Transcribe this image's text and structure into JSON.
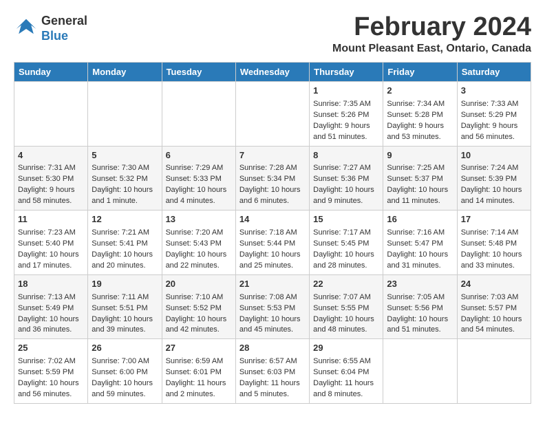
{
  "header": {
    "logo_line1": "General",
    "logo_line2": "Blue",
    "month": "February 2024",
    "location": "Mount Pleasant East, Ontario, Canada"
  },
  "days_of_week": [
    "Sunday",
    "Monday",
    "Tuesday",
    "Wednesday",
    "Thursday",
    "Friday",
    "Saturday"
  ],
  "weeks": [
    [
      {
        "day": "",
        "text": ""
      },
      {
        "day": "",
        "text": ""
      },
      {
        "day": "",
        "text": ""
      },
      {
        "day": "",
        "text": ""
      },
      {
        "day": "1",
        "text": "Sunrise: 7:35 AM\nSunset: 5:26 PM\nDaylight: 9 hours\nand 51 minutes."
      },
      {
        "day": "2",
        "text": "Sunrise: 7:34 AM\nSunset: 5:28 PM\nDaylight: 9 hours\nand 53 minutes."
      },
      {
        "day": "3",
        "text": "Sunrise: 7:33 AM\nSunset: 5:29 PM\nDaylight: 9 hours\nand 56 minutes."
      }
    ],
    [
      {
        "day": "4",
        "text": "Sunrise: 7:31 AM\nSunset: 5:30 PM\nDaylight: 9 hours\nand 58 minutes."
      },
      {
        "day": "5",
        "text": "Sunrise: 7:30 AM\nSunset: 5:32 PM\nDaylight: 10 hours\nand 1 minute."
      },
      {
        "day": "6",
        "text": "Sunrise: 7:29 AM\nSunset: 5:33 PM\nDaylight: 10 hours\nand 4 minutes."
      },
      {
        "day": "7",
        "text": "Sunrise: 7:28 AM\nSunset: 5:34 PM\nDaylight: 10 hours\nand 6 minutes."
      },
      {
        "day": "8",
        "text": "Sunrise: 7:27 AM\nSunset: 5:36 PM\nDaylight: 10 hours\nand 9 minutes."
      },
      {
        "day": "9",
        "text": "Sunrise: 7:25 AM\nSunset: 5:37 PM\nDaylight: 10 hours\nand 11 minutes."
      },
      {
        "day": "10",
        "text": "Sunrise: 7:24 AM\nSunset: 5:39 PM\nDaylight: 10 hours\nand 14 minutes."
      }
    ],
    [
      {
        "day": "11",
        "text": "Sunrise: 7:23 AM\nSunset: 5:40 PM\nDaylight: 10 hours\nand 17 minutes."
      },
      {
        "day": "12",
        "text": "Sunrise: 7:21 AM\nSunset: 5:41 PM\nDaylight: 10 hours\nand 20 minutes."
      },
      {
        "day": "13",
        "text": "Sunrise: 7:20 AM\nSunset: 5:43 PM\nDaylight: 10 hours\nand 22 minutes."
      },
      {
        "day": "14",
        "text": "Sunrise: 7:18 AM\nSunset: 5:44 PM\nDaylight: 10 hours\nand 25 minutes."
      },
      {
        "day": "15",
        "text": "Sunrise: 7:17 AM\nSunset: 5:45 PM\nDaylight: 10 hours\nand 28 minutes."
      },
      {
        "day": "16",
        "text": "Sunrise: 7:16 AM\nSunset: 5:47 PM\nDaylight: 10 hours\nand 31 minutes."
      },
      {
        "day": "17",
        "text": "Sunrise: 7:14 AM\nSunset: 5:48 PM\nDaylight: 10 hours\nand 33 minutes."
      }
    ],
    [
      {
        "day": "18",
        "text": "Sunrise: 7:13 AM\nSunset: 5:49 PM\nDaylight: 10 hours\nand 36 minutes."
      },
      {
        "day": "19",
        "text": "Sunrise: 7:11 AM\nSunset: 5:51 PM\nDaylight: 10 hours\nand 39 minutes."
      },
      {
        "day": "20",
        "text": "Sunrise: 7:10 AM\nSunset: 5:52 PM\nDaylight: 10 hours\nand 42 minutes."
      },
      {
        "day": "21",
        "text": "Sunrise: 7:08 AM\nSunset: 5:53 PM\nDaylight: 10 hours\nand 45 minutes."
      },
      {
        "day": "22",
        "text": "Sunrise: 7:07 AM\nSunset: 5:55 PM\nDaylight: 10 hours\nand 48 minutes."
      },
      {
        "day": "23",
        "text": "Sunrise: 7:05 AM\nSunset: 5:56 PM\nDaylight: 10 hours\nand 51 minutes."
      },
      {
        "day": "24",
        "text": "Sunrise: 7:03 AM\nSunset: 5:57 PM\nDaylight: 10 hours\nand 54 minutes."
      }
    ],
    [
      {
        "day": "25",
        "text": "Sunrise: 7:02 AM\nSunset: 5:59 PM\nDaylight: 10 hours\nand 56 minutes."
      },
      {
        "day": "26",
        "text": "Sunrise: 7:00 AM\nSunset: 6:00 PM\nDaylight: 10 hours\nand 59 minutes."
      },
      {
        "day": "27",
        "text": "Sunrise: 6:59 AM\nSunset: 6:01 PM\nDaylight: 11 hours\nand 2 minutes."
      },
      {
        "day": "28",
        "text": "Sunrise: 6:57 AM\nSunset: 6:03 PM\nDaylight: 11 hours\nand 5 minutes."
      },
      {
        "day": "29",
        "text": "Sunrise: 6:55 AM\nSunset: 6:04 PM\nDaylight: 11 hours\nand 8 minutes."
      },
      {
        "day": "",
        "text": ""
      },
      {
        "day": "",
        "text": ""
      }
    ]
  ]
}
